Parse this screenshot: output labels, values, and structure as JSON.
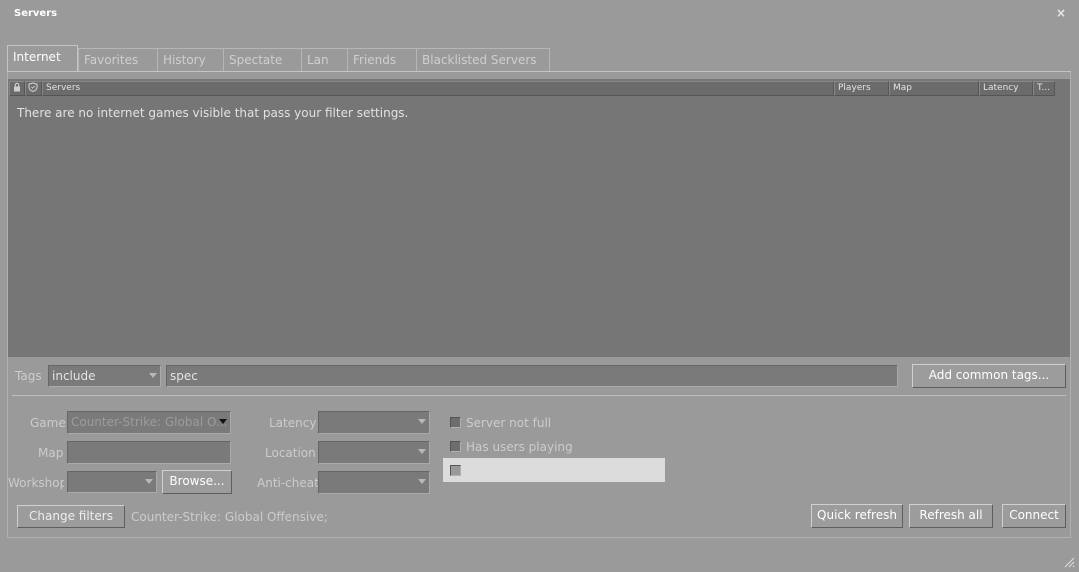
{
  "window": {
    "title": "Servers",
    "close_glyph": "×"
  },
  "tabs": [
    {
      "label": "Internet"
    },
    {
      "label": "Favorites"
    },
    {
      "label": "History"
    },
    {
      "label": "Spectate"
    },
    {
      "label": "Lan"
    },
    {
      "label": "Friends"
    },
    {
      "label": "Blacklisted Servers"
    }
  ],
  "list": {
    "columns": {
      "servers": "Servers",
      "players": "Players",
      "map": "Map",
      "latency": "Latency",
      "tags": "T..."
    },
    "empty_message": "There are no internet games visible that pass your filter settings."
  },
  "tags_row": {
    "label": "Tags",
    "mode": "include",
    "value": "spec",
    "add_button": "Add common tags..."
  },
  "filters": {
    "game_label": "Game",
    "game_value": "Counter-Strike: Global O...",
    "map_label": "Map",
    "map_value": "",
    "workshop_label": "Workshop",
    "browse_button": "Browse...",
    "latency_label": "Latency",
    "location_label": "Location",
    "anticheat_label": "Anti-cheat",
    "server_not_full": "Server not full",
    "has_users_playing": "Has users playing"
  },
  "footer": {
    "change_filters": "Change filters",
    "filter_summary": "Counter-Strike: Global Offensive;",
    "quick_refresh": "Quick refresh",
    "refresh_all": "Refresh all",
    "connect": "Connect"
  },
  "icons": {
    "lock": "lock-icon",
    "shield": "shield-icon",
    "close": "close-icon",
    "resize": "resize-grip-icon"
  }
}
